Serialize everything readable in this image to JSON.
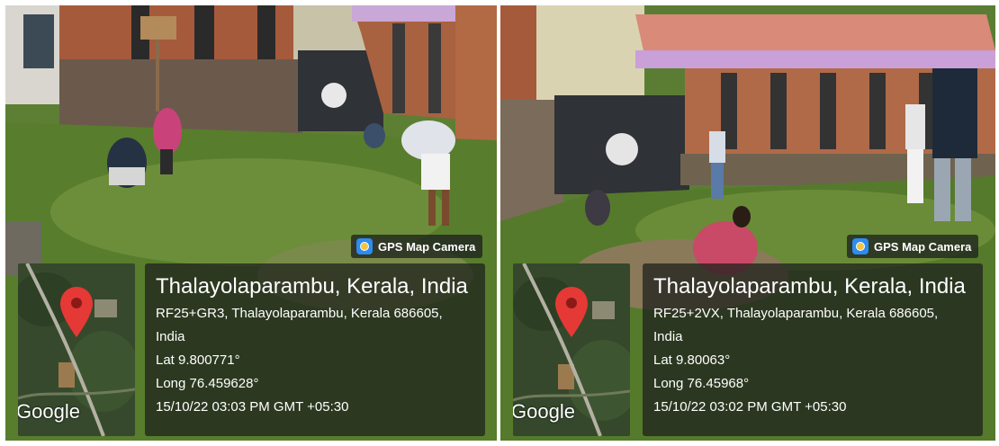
{
  "photos": [
    {
      "stamp_label": "GPS Map Camera",
      "map_brand": "Google",
      "place": "Thalayolaparambu, Kerala, India",
      "address_line1": "RF25+GR3, Thalayolaparambu, Kerala 686605,",
      "address_line2": "India",
      "lat": "Lat 9.800771°",
      "long": "Long 76.459628°",
      "datetime": "15/10/22 03:03 PM GMT +05:30"
    },
    {
      "stamp_label": "GPS Map Camera",
      "map_brand": "Google",
      "place": "Thalayolaparambu, Kerala, India",
      "address_line1": "RF25+2VX, Thalayolaparambu, Kerala 686605,",
      "address_line2": "India",
      "lat": "Lat 9.80063°",
      "long": "Long 76.45968°",
      "datetime": "15/10/22 03:02 PM GMT +05:30"
    }
  ],
  "colors": {
    "grass": "#4f7a2e",
    "brick": "#a65a3c",
    "roof": "#d98a78",
    "pin": "#e53935",
    "overlay": "#1c201c"
  },
  "icons": [
    "gps-camera-icon",
    "map-pin-icon"
  ]
}
